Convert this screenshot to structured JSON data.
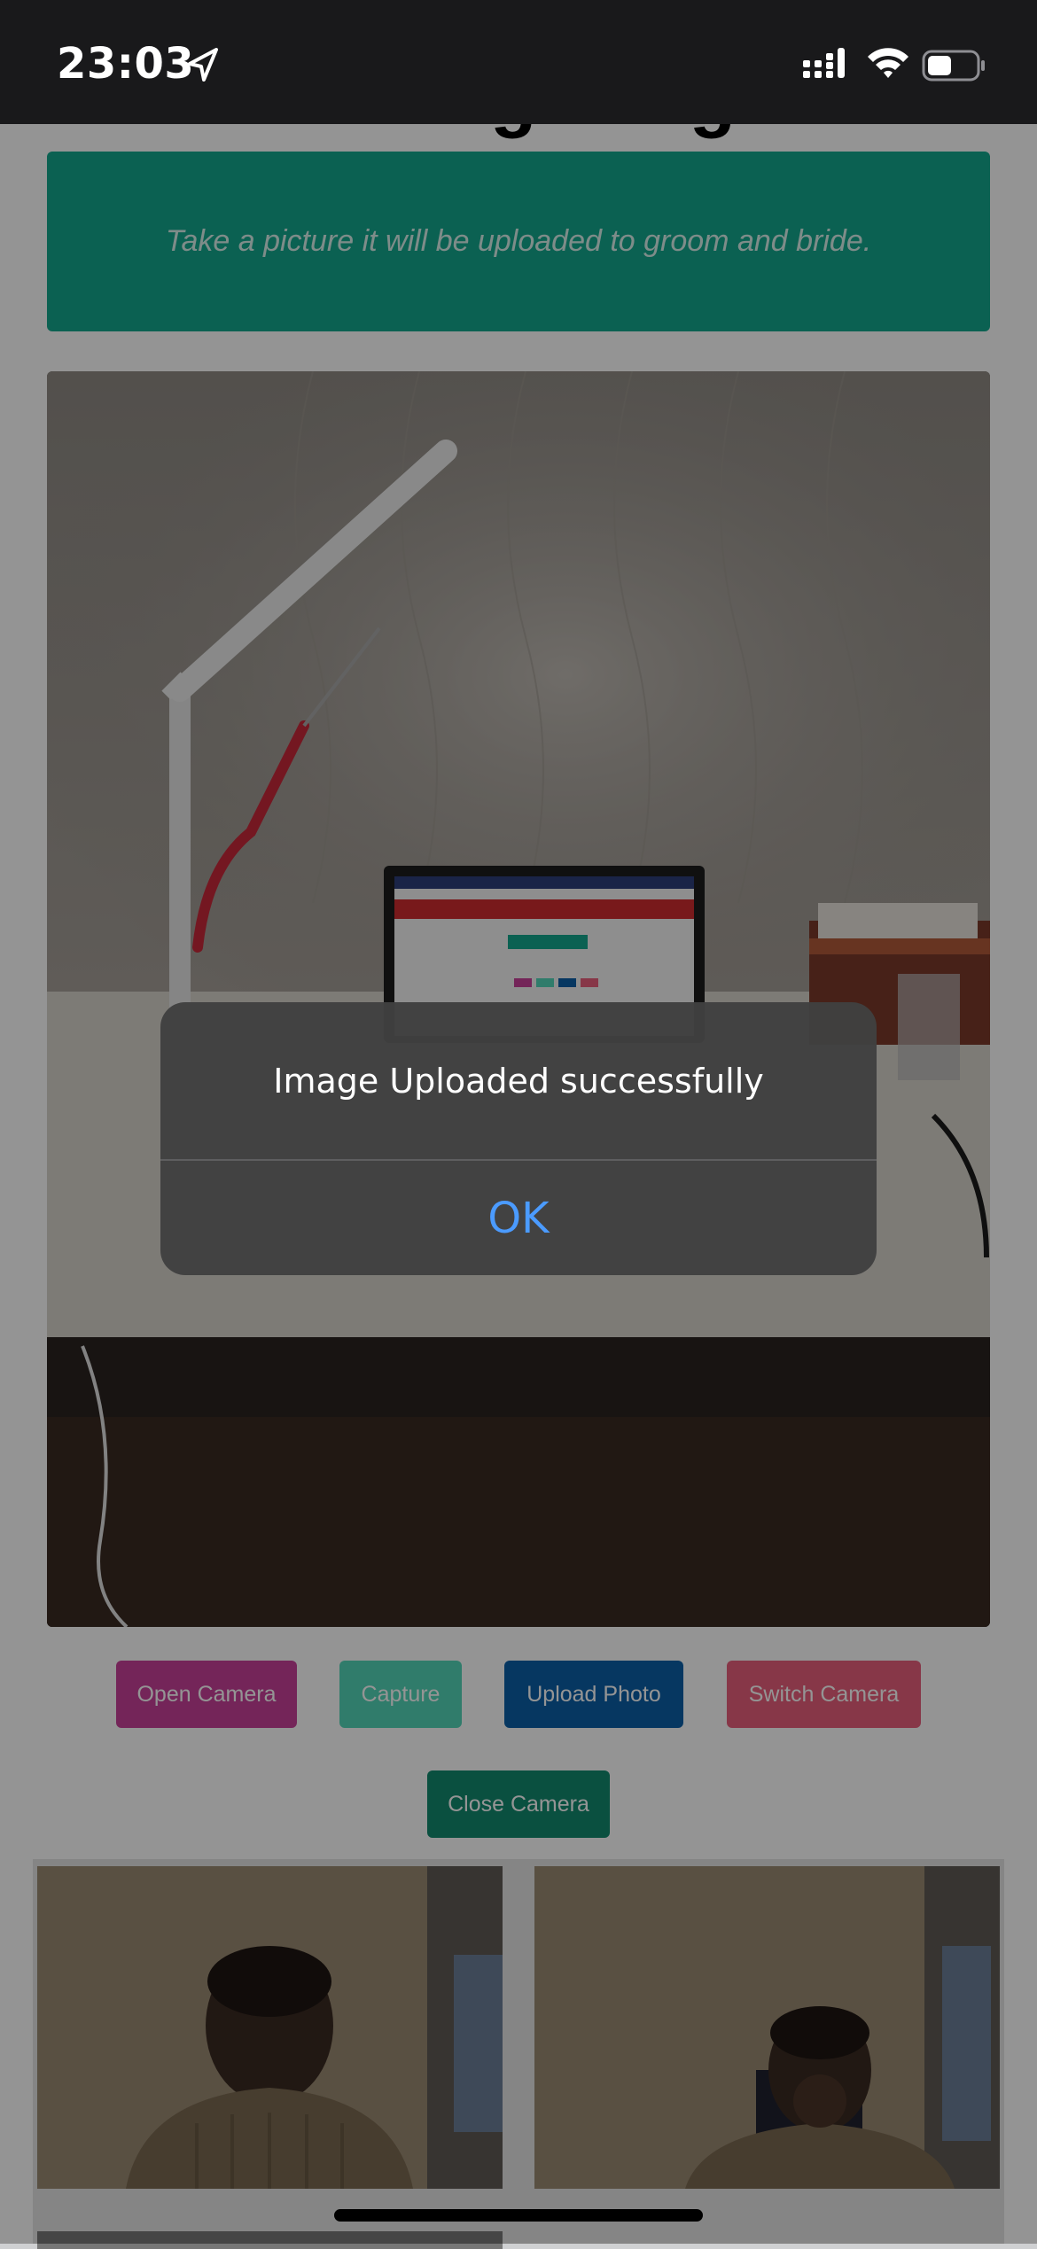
{
  "status_bar": {
    "time": "23:03",
    "location_icon": "location-arrow-icon",
    "signal_icon": "cellular-signal-icon",
    "wifi_icon": "wifi-icon",
    "battery_icon": "battery-icon",
    "battery_level": 0.5
  },
  "page": {
    "title_partial": "Wedding Images",
    "banner_text": "Take a picture it will be uploaded to groom and bride.",
    "banner_color": "#14a88e"
  },
  "buttons": {
    "open_camera": "Open Camera",
    "capture": "Capture",
    "upload_photo": "Upload Photo",
    "switch_camera": "Switch Camera",
    "close_camera": "Close Camera"
  },
  "button_colors": {
    "open_camera": "#c8409a",
    "capture": "#54d6b8",
    "upload_photo": "#0b5fa8",
    "switch_camera": "#e8607c",
    "close_camera": "#128a6f"
  },
  "alert": {
    "message": "Image Uploaded successfully",
    "ok_label": "OK",
    "ok_color": "#4b9bff"
  }
}
